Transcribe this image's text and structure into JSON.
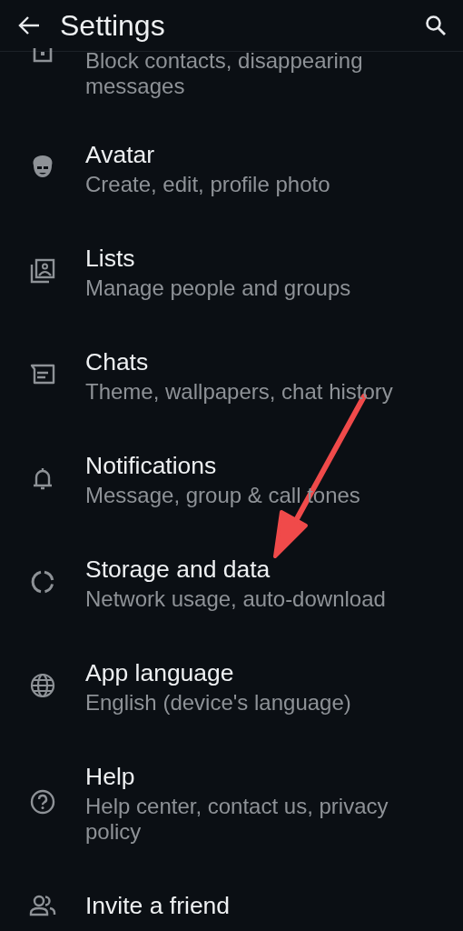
{
  "header": {
    "title": "Settings"
  },
  "items": [
    {
      "subtitle": "Block contacts, disappearing messages"
    },
    {
      "title": "Avatar",
      "subtitle": "Create, edit, profile photo"
    },
    {
      "title": "Lists",
      "subtitle": "Manage people and groups"
    },
    {
      "title": "Chats",
      "subtitle": "Theme, wallpapers, chat history"
    },
    {
      "title": "Notifications",
      "subtitle": "Message, group & call tones"
    },
    {
      "title": "Storage and data",
      "subtitle": "Network usage, auto-download"
    },
    {
      "title": "App language",
      "subtitle": "English (device's language)"
    },
    {
      "title": "Help",
      "subtitle": "Help center, contact us, privacy policy"
    },
    {
      "title": "Invite a friend"
    }
  ],
  "annotations": [
    {
      "kind": "arrow",
      "color": "#f04a4a"
    }
  ]
}
